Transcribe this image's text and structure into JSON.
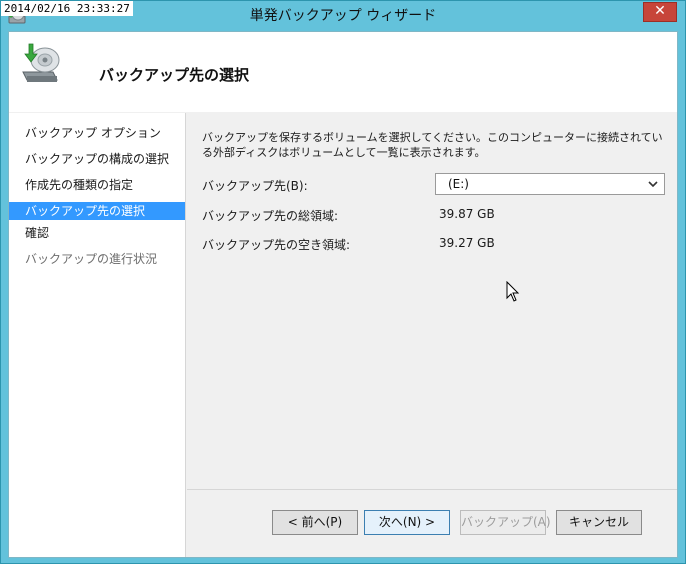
{
  "overlay": {
    "timestamp": "2014/02/16 23:33:27"
  },
  "window": {
    "title": "単発バックアップ ウィザード",
    "close_glyph": "✕"
  },
  "header": {
    "title": "バックアップ先の選択"
  },
  "nav": {
    "items": [
      {
        "label": "バックアップ オプション",
        "state": "normal"
      },
      {
        "label": "バックアップの構成の選択",
        "state": "normal"
      },
      {
        "label": "作成先の種類の指定",
        "state": "normal"
      },
      {
        "label": "バックアップ先の選択",
        "state": "selected"
      },
      {
        "label": "確認",
        "state": "normal"
      },
      {
        "label": "バックアップの進行状況",
        "state": "disabled"
      }
    ]
  },
  "main": {
    "description": "バックアップを保存するボリュームを選択してください。このコンピューターに接続されている外部ディスクはボリュームとして一覧に表示されます。",
    "destination": {
      "label": "バックアップ先(B):",
      "selected": "(E:)"
    },
    "total": {
      "label": "バックアップ先の総領域:",
      "value": "39.87 GB"
    },
    "free": {
      "label": "バックアップ先の空き領域:",
      "value": "39.27 GB"
    }
  },
  "buttons": {
    "back": "< 前へ(P)",
    "next": "次へ(N) >",
    "backup": "バックアップ(A)",
    "cancel": "キャンセル"
  },
  "colors": {
    "selection": "#3399ff",
    "titlebar": "#63c2db",
    "close": "#c7453a"
  },
  "icons": {
    "app": "backup-drive-icon",
    "cursor": "mouse-pointer-icon",
    "dropdown": "chevron-down-icon"
  }
}
